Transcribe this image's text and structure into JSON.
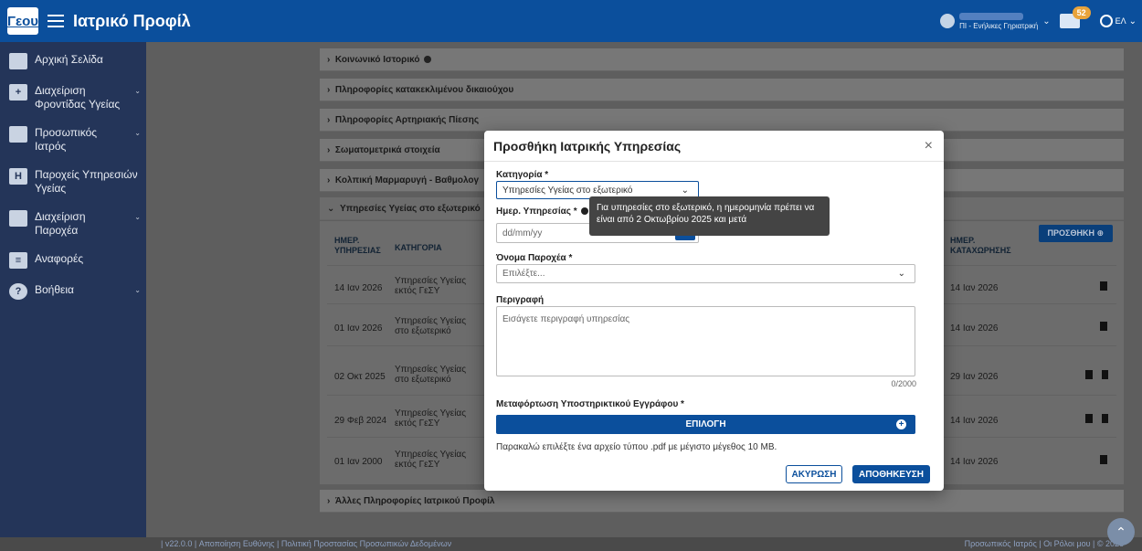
{
  "header": {
    "logo": "Γεου",
    "title": "Ιατρικό Προφίλ",
    "user_role": "ΠΙ - Ενήλικες Γηριατρική",
    "messages_count": "52",
    "language": "ΕΛ"
  },
  "sidebar": {
    "items": [
      {
        "label": "Αρχική Σελίδα",
        "icon": "H"
      },
      {
        "label": "Διαχείριση Φροντίδας Υγείας",
        "icon": "+"
      },
      {
        "label": "Προσωπικός Ιατρός",
        "icon": "•"
      },
      {
        "label": "Παροχείς Υπηρεσιών Υγείας",
        "icon": "H"
      },
      {
        "label": "Διαχείριση Παροχέα",
        "icon": "▬"
      },
      {
        "label": "Αναφορές",
        "icon": "≡"
      },
      {
        "label": "Βοήθεια",
        "icon": "?"
      }
    ]
  },
  "sections": [
    "Κοινωνικό Ιστορικό",
    "Πληροφορίες κατακεκλιμένου δικαιούχου",
    "Πληροφορίες Αρτηριακής Πίεσης",
    "Σωματομετρικά στοιχεία",
    "Κολπική Μαρμαρυγή - Βαθμολογ",
    "Υπηρεσίες Υγείας στο εξωτερικό",
    "Άλλες Πληροφορίες Ιατρικού Προφίλ"
  ],
  "table": {
    "add_label": "ΠΡΟΣΘΗΚΗ",
    "col_date": "ΗΜΕΡ. ΥΠΗΡΕΣΙΑΣ",
    "col_category": "ΚΑΤΗΓΟΡΙΑ",
    "col_registered": "ΗΜΕΡ. ΚΑΤΑΧΩΡΗΣΗΣ",
    "rows": [
      {
        "date": "14 Ιαν 2026",
        "category": "Υπηρεσίες Υγείας εκτός ΓεΣΥ",
        "registered": "14 Ιαν 2026"
      },
      {
        "date": "01 Ιαν 2026",
        "category": "Υπηρεσίες Υγείας στο εξωτερικό",
        "registered": "14 Ιαν 2026"
      },
      {
        "date": "02 Οκτ 2025",
        "category": "Υπηρεσίες Υγείας στο εξωτερικό",
        "registered": "29 Ιαν 2026"
      },
      {
        "date": "29 Φεβ 2024",
        "category": "Υπηρεσίες Υγείας εκτός ΓεΣΥ",
        "registered": "14 Ιαν 2026"
      },
      {
        "date": "01 Ιαν 2000",
        "category": "Υπηρεσίες Υγείας εκτός ΓεΣΥ",
        "registered": "14 Ιαν 2026"
      }
    ]
  },
  "modal": {
    "title": "Προσθήκη Ιατρικής Υπηρεσίας",
    "category_label": "Κατηγορία *",
    "category_value": "Υπηρεσίες Υγείας στο εξωτερικό",
    "date_label": "Ημερ. Υπηρεσίας *",
    "date_placeholder": "dd/mm/yy",
    "tooltip": "Για υπηρεσίες στο εξωτερικό, η ημερομηνία πρέπει να είναι από 2 Οκτωβρίου 2025 και μετά",
    "provider_label": "Όνομα Παροχέα *",
    "provider_placeholder": "Επιλέξτε...",
    "description_label": "Περιγραφή",
    "description_placeholder": "Εισάγετε περιγραφή υπηρεσίας",
    "char_count": "0/2000",
    "upload_label": "Μεταφόρτωση Υποστηρικτικού Εγγράφου *",
    "upload_button": "ΕΠΙΛΟΓΗ",
    "upload_hint": "Παρακαλώ επιλέξτε ένα αρχείο τύπου .pdf με μέγιστο μέγεθος 10 MB.",
    "cancel_button": "ΑΚΥΡΩΣΗ",
    "save_button": "ΑΠΟΘΗΚΕΥΣΗ"
  },
  "footer": {
    "left": "| v22.0.0 | Αποποίηση Ευθύνης | Πολιτική Προστασίας Προσωπικών Δεδομένων",
    "right": "Προσωπικός Ιατρός | Οι Ρόλοι μου | © 2026"
  },
  "colors": {
    "primary": "#0b4f9c",
    "sidebar": "#243559"
  }
}
